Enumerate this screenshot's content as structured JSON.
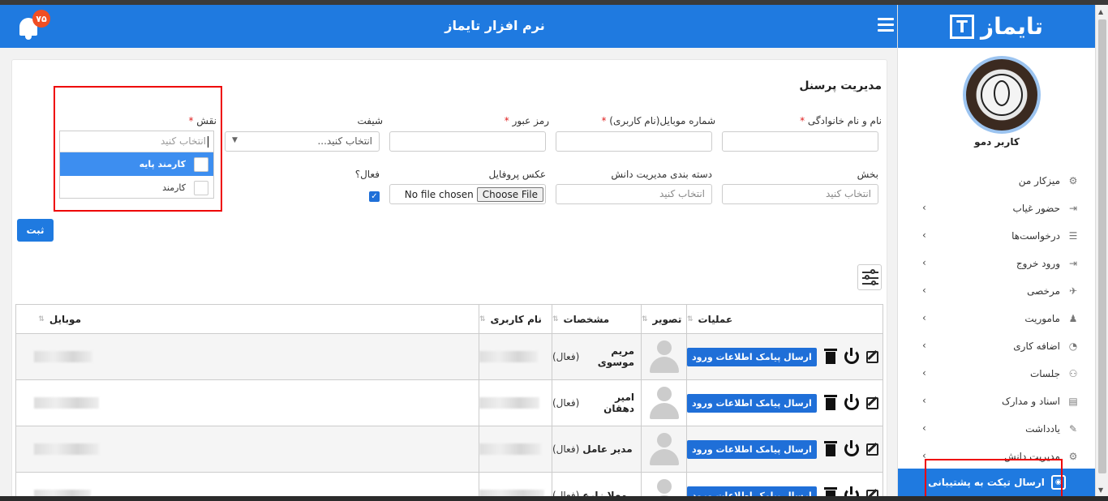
{
  "app": {
    "brand": "تایماز",
    "header_title": "نرم افزار تایماز",
    "notification_count": "۷۵"
  },
  "sidebar": {
    "username": "کاربر دمو",
    "items": [
      {
        "label": "میزکار من",
        "icon": "dashboard-icon",
        "has_chevron": false
      },
      {
        "label": "حضور غیاب",
        "icon": "attendance-icon",
        "has_chevron": true
      },
      {
        "label": "درخواست‌ها",
        "icon": "requests-icon",
        "has_chevron": true
      },
      {
        "label": "ورود خروج",
        "icon": "login-icon",
        "has_chevron": true
      },
      {
        "label": "مرخصی",
        "icon": "leave-icon",
        "has_chevron": true
      },
      {
        "label": "ماموریت",
        "icon": "mission-icon",
        "has_chevron": true
      },
      {
        "label": "اضافه کاری",
        "icon": "overtime-icon",
        "has_chevron": true
      },
      {
        "label": "جلسات",
        "icon": "meetings-icon",
        "has_chevron": true
      },
      {
        "label": "اسناد و مدارک",
        "icon": "documents-icon",
        "has_chevron": true
      },
      {
        "label": "یادداشت",
        "icon": "note-icon",
        "has_chevron": true
      },
      {
        "label": "مدیریت دانش",
        "icon": "knowledge-icon",
        "has_chevron": true
      }
    ],
    "ticket_button": "ارسال تیکت به پشتیبانی"
  },
  "form": {
    "page_title": "مدیریت پرسنل",
    "fullname_label": "نام و نام خانوادگی",
    "mobile_label": "شماره موبایل(نام کاربری)",
    "password_label": "رمز عبور",
    "shift_label": "شیفت",
    "shift_placeholder": "انتخاب کنید...",
    "role_label": "نقش",
    "role_search_placeholder": "انتخاب کنید",
    "role_options": [
      "کارمند پایه",
      "کارمند"
    ],
    "department_label": "بخش",
    "department_placeholder": "انتخاب کنید",
    "knowledge_label": "دسته بندی مدیریت دانش",
    "knowledge_placeholder": "انتخاب کنید",
    "profile_image_label": "عکس پروفایل",
    "file_button": "Choose File",
    "file_status": "No file chosen",
    "active_label": "فعال؟",
    "active_checked": true,
    "submit_label": "ثبت",
    "required_mark": "*"
  },
  "table": {
    "headers": [
      "عملیات",
      "تصویر",
      "مشخصات",
      "نام کاربری",
      "موبایل"
    ],
    "sms_button": "ارسال پیامک اطلاعات ورود",
    "rows": [
      {
        "name": "مریم موسوی",
        "status": "(فعال)"
      },
      {
        "name": "امیر دهقان",
        "status": "(فعال)"
      },
      {
        "name": "مدیر عامل",
        "status": "(فعال)"
      },
      {
        "name": "مهلا زارع",
        "status": "(فعال)"
      }
    ]
  },
  "colors": {
    "primary": "#1f7ae0",
    "badge": "#f04e23",
    "highlight_border": "#e00000"
  }
}
